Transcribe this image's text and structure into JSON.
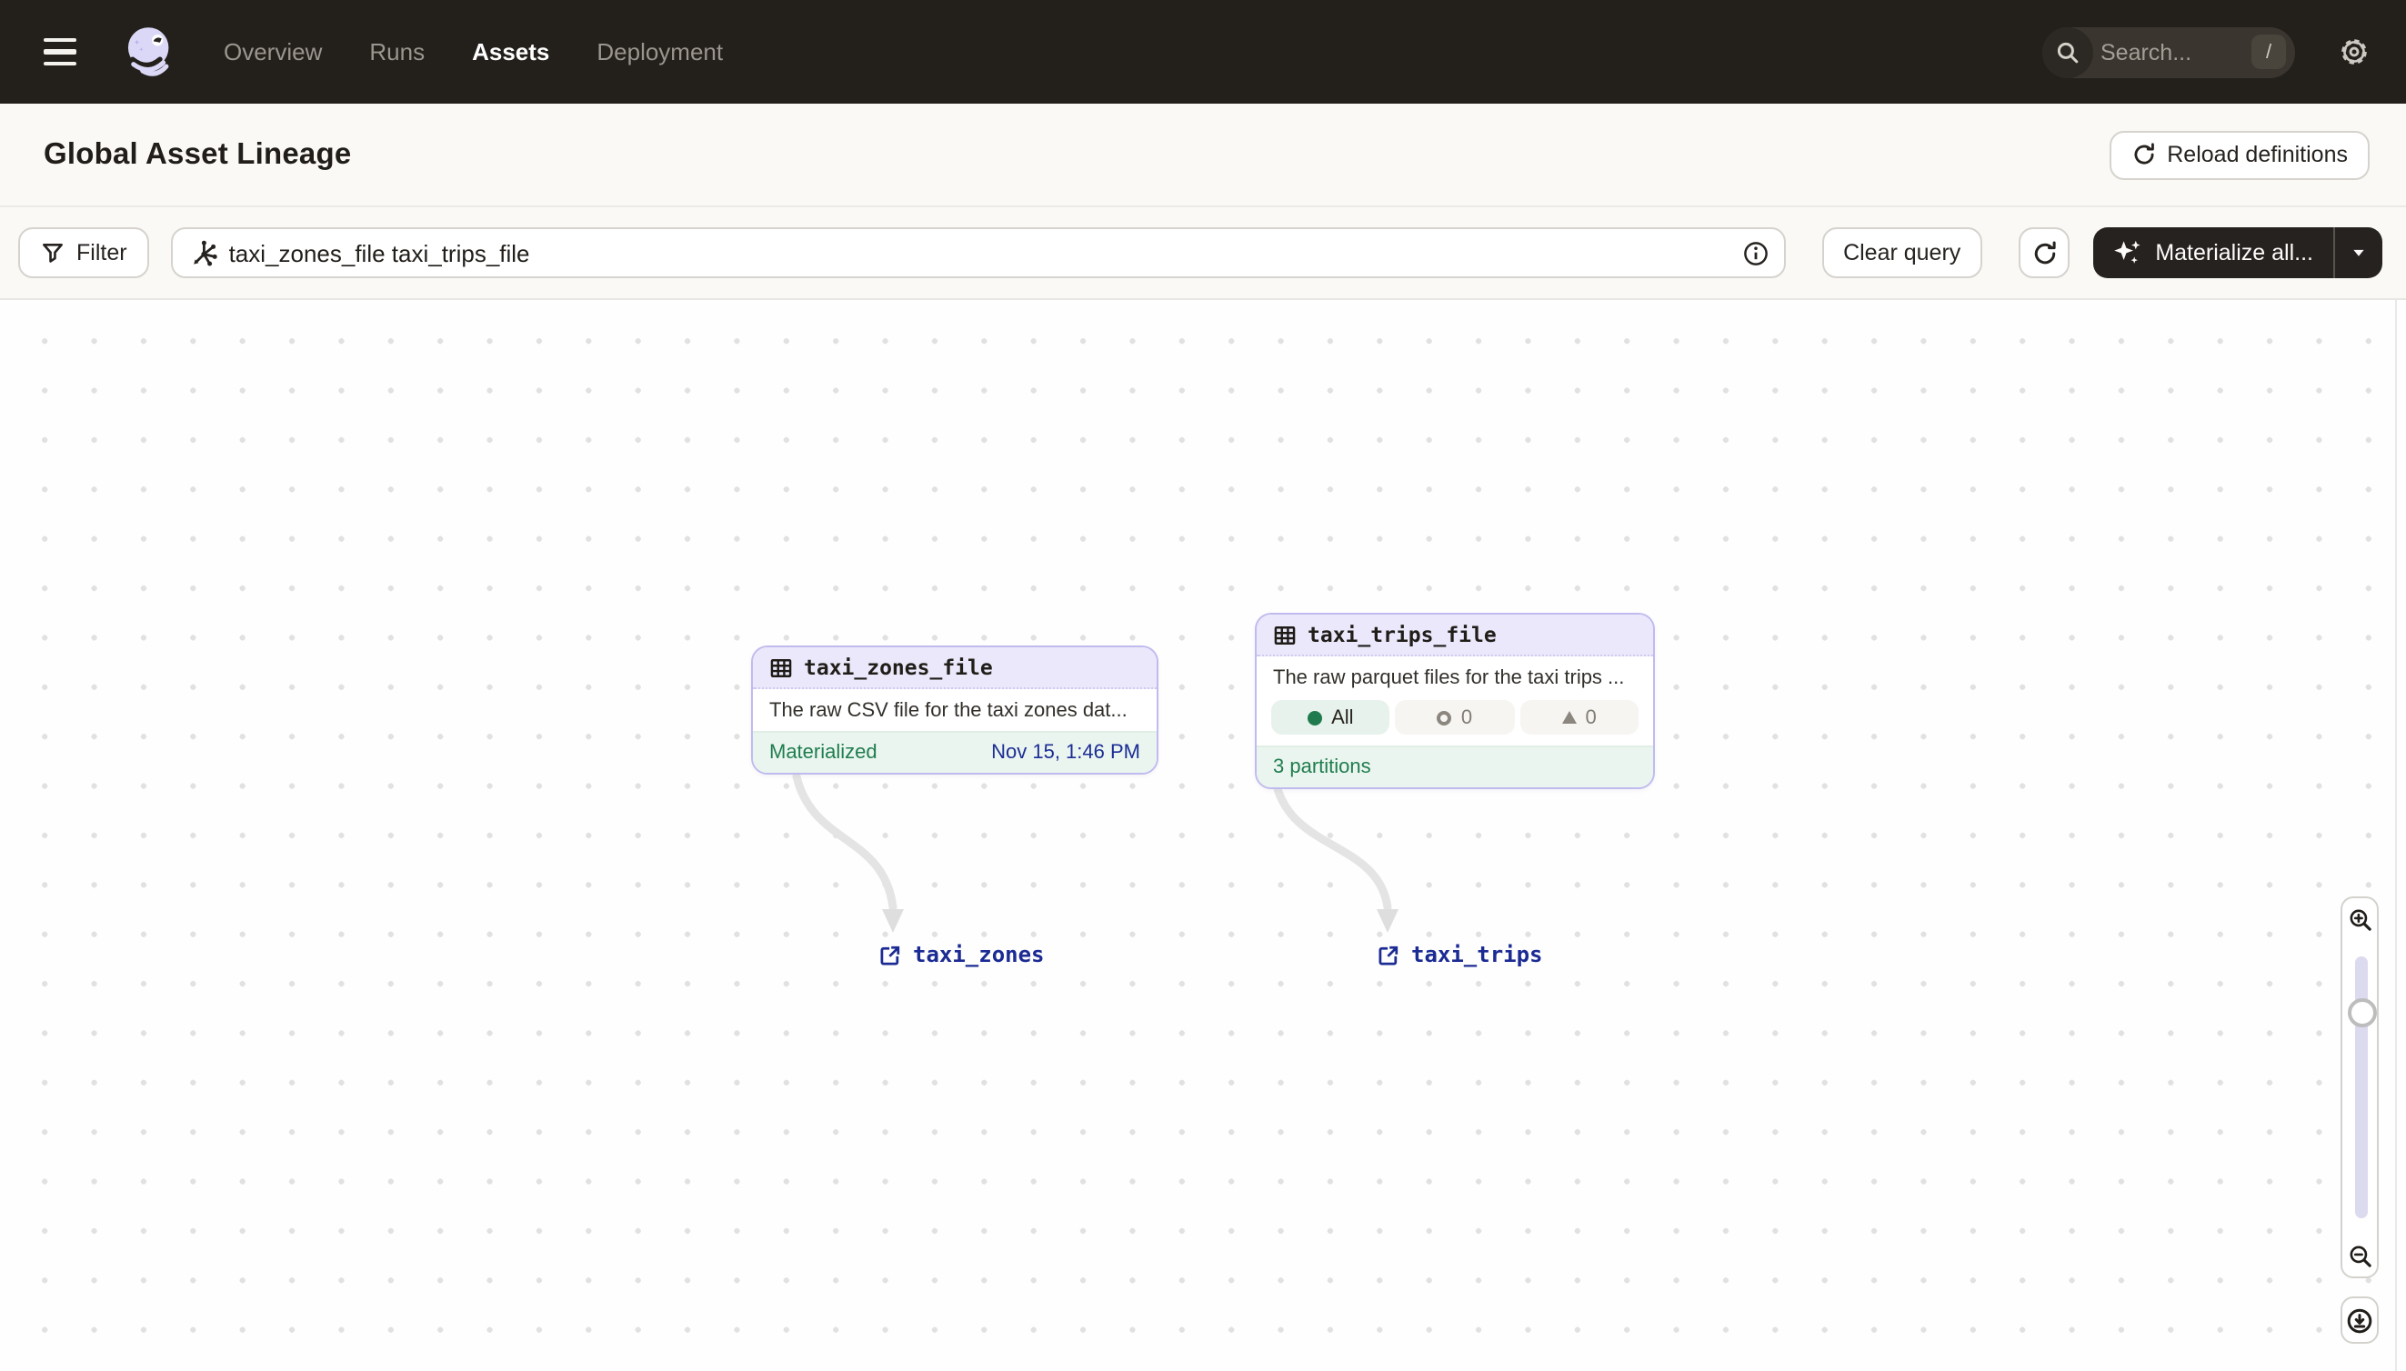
{
  "nav": {
    "items": [
      {
        "label": "Overview"
      },
      {
        "label": "Runs"
      },
      {
        "label": "Assets"
      },
      {
        "label": "Deployment"
      }
    ],
    "active_item": "Assets",
    "search": {
      "placeholder": "Search...",
      "shortcut": "/"
    }
  },
  "header": {
    "title": "Global Asset Lineage",
    "reload_button": "Reload definitions"
  },
  "toolbar": {
    "filter_button": "Filter",
    "query": "taxi_zones_file taxi_trips_file",
    "clear_button": "Clear query",
    "materialize_button": "Materialize all..."
  },
  "graph": {
    "nodes": {
      "taxi_zones_file": {
        "title": "taxi_zones_file",
        "description": "The raw CSV file for the taxi zones dat...",
        "status": "Materialized",
        "timestamp": "Nov 15, 1:46 PM"
      },
      "taxi_trips_file": {
        "title": "taxi_trips_file",
        "description": "The raw parquet files for the taxi trips ...",
        "partition_all_label": "All",
        "partition_missing_count": "0",
        "partition_failed_count": "0",
        "footer": "3 partitions"
      }
    },
    "external_assets": {
      "taxi_zones": "taxi_zones",
      "taxi_trips": "taxi_trips"
    }
  },
  "colors": {
    "nav_bg": "#231F1B",
    "accent_purple": "#C0BBEE",
    "node_header_bg": "#EAE8FA",
    "success_green": "#1E7D4E",
    "success_bg": "#EBF5EF",
    "timestamp_navy": "#1B2D95",
    "link_navy": "#1B2B93"
  }
}
